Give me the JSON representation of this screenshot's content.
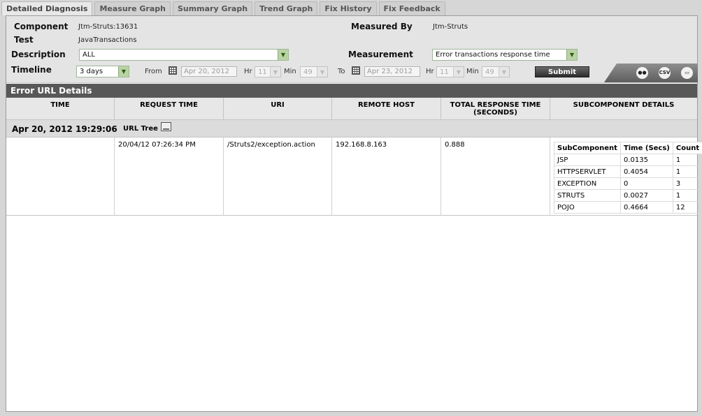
{
  "tabs": [
    {
      "label": "Detailed Diagnosis"
    },
    {
      "label": "Measure Graph"
    },
    {
      "label": "Summary Graph"
    },
    {
      "label": "Trend Graph"
    },
    {
      "label": "Fix History"
    },
    {
      "label": "Fix Feedback"
    }
  ],
  "filters": {
    "component_label": "Component",
    "component_value": "Jtm-Struts:13631",
    "test_label": "Test",
    "test_value": "JavaTransactions",
    "measured_by_label": "Measured By",
    "measured_by_value": "Jtm-Struts",
    "description_label": "Description",
    "description_value": "ALL",
    "measurement_label": "Measurement",
    "measurement_value": "Error transactions response time",
    "timeline_label": "Timeline",
    "timeline_value": "3 days",
    "from_label": "From",
    "from_date": "Apr 20, 2012",
    "from_hr_label": "Hr",
    "from_hr": "11",
    "from_min_label": "Min",
    "from_min": "49",
    "to_label": "To",
    "to_date": "Apr 23, 2012",
    "to_hr_label": "Hr",
    "to_hr": "11",
    "to_min_label": "Min",
    "to_min": "49",
    "submit_label": "Submit"
  },
  "toolbar_icons": {
    "csv_label": "CSV"
  },
  "section_title": "Error URL Details",
  "columns": [
    "TIME",
    "REQUEST TIME",
    "URI",
    "REMOTE HOST",
    "TOTAL RESPONSE TIME\n(SECONDS)",
    "SUBCOMPONENT DETAILS"
  ],
  "group": {
    "date": "Apr 20, 2012 19:29:06",
    "tree_label": "URL Tree"
  },
  "row": {
    "time": "",
    "request_time": "20/04/12 07:26:34 PM",
    "uri": "/Struts2/exception.action",
    "remote_host": "192.168.8.163",
    "total_response_time": "0.888"
  },
  "subcomponents": {
    "headers": [
      "SubComponent",
      "Time (Secs)",
      "Count"
    ],
    "rows": [
      [
        "JSP",
        "0.0135",
        "1"
      ],
      [
        "HTTPSERVLET",
        "0.4054",
        "1"
      ],
      [
        "EXCEPTION",
        "0",
        "3"
      ],
      [
        "STRUTS",
        "0.0027",
        "1"
      ],
      [
        "POJO",
        "0.4664",
        "12"
      ]
    ]
  }
}
